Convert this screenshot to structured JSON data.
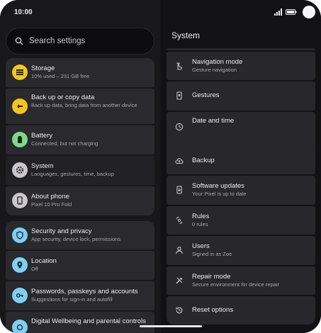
{
  "status": {
    "time": "10:00"
  },
  "search": {
    "placeholder": "Search settings"
  },
  "left": {
    "group1": [
      {
        "title": "Storage",
        "subtitle": "10% used – 231 GB free",
        "icon": "storage-icon",
        "color": "#f5c518"
      },
      {
        "title": "Back up or copy data",
        "subtitle": "Back up data, bring data from another device",
        "icon": "backup-data-icon",
        "color": "#f5c518"
      },
      {
        "title": "Battery",
        "subtitle": "Connected, but not charging",
        "icon": "battery-icon",
        "color": "#7fd98a"
      },
      {
        "title": "System",
        "subtitle": "Languages, gestures, time, backup",
        "icon": "gear-icon",
        "color": "#c9c6cc"
      },
      {
        "title": "About phone",
        "subtitle": "Pixel 10 Pro Fold",
        "icon": "phone-icon",
        "color": "#c9c6cc"
      }
    ],
    "group2": [
      {
        "title": "Security and privacy",
        "subtitle": "App security, device lock, permissions",
        "icon": "shield-icon",
        "color": "#7fd0f0"
      },
      {
        "title": "Location",
        "subtitle": "Off",
        "icon": "location-pin-icon",
        "color": "#7fd0f0"
      },
      {
        "title": "Passwords, passkeys and accounts",
        "subtitle": "Suggestions for sign-in and autofill",
        "icon": "key-icon",
        "color": "#7fd0f0"
      },
      {
        "title": "Digital Wellbeing and parental controls",
        "subtitle": "",
        "icon": "wellbeing-icon",
        "color": "#7fd0f0"
      }
    ]
  },
  "right": {
    "title": "System",
    "items": [
      {
        "title": "Navigation mode",
        "subtitle": "Gesture navigation",
        "icon": "navigation-gesture-icon"
      },
      {
        "title": "Gestures",
        "subtitle": "",
        "icon": "phone-gestures-icon"
      },
      {
        "title": "Date and time",
        "subtitle": "",
        "icon": "clock-icon"
      },
      {
        "title": "Backup",
        "subtitle": "",
        "icon": "cloud-backup-icon"
      },
      {
        "title": "Software updates",
        "subtitle": "Your Pixel is up to date",
        "icon": "system-update-icon"
      },
      {
        "title": "Rules",
        "subtitle": "0 rules",
        "icon": "rules-icon"
      },
      {
        "title": "Users",
        "subtitle": "Signed in as Zoe",
        "icon": "user-icon"
      },
      {
        "title": "Repair mode",
        "subtitle": "Secure environment for device repair",
        "icon": "repair-tools-icon"
      },
      {
        "title": "Reset options",
        "subtitle": "",
        "icon": "reset-icon"
      }
    ]
  }
}
